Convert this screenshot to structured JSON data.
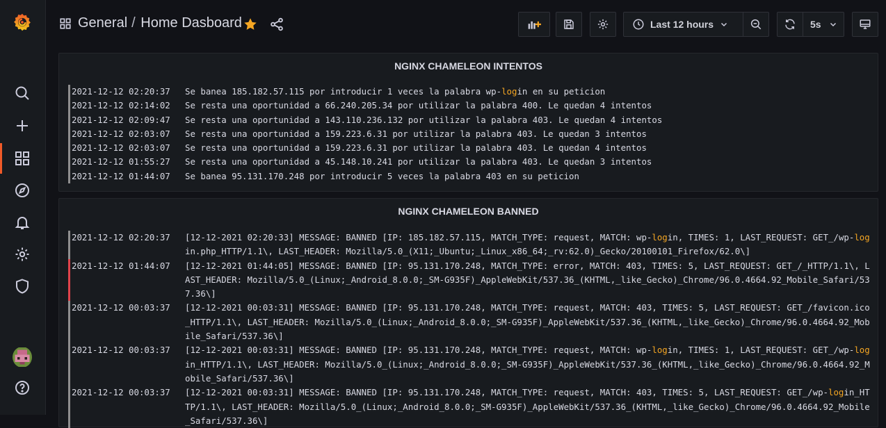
{
  "breadcrumb": {
    "folder": "General",
    "separator": "/",
    "dashboard": "Home Dasboard"
  },
  "toolbar": {
    "time_range": "Last 12 hours",
    "refresh_interval": "5s"
  },
  "colors": {
    "accent": "#f05a28",
    "highlight": "#f5a623",
    "error": "#e0434b"
  },
  "sidebar": {
    "icons": [
      "grafana-logo-icon",
      "search-icon",
      "plus-icon",
      "dashboards-icon",
      "explore-icon",
      "alert-bell-icon",
      "settings-gear-icon",
      "shield-icon",
      "user-avatar",
      "help-icon"
    ]
  },
  "panels": [
    {
      "title": "NGINX CHAMELEON INTENTOS",
      "rows": [
        {
          "ts": "2021-12-12 02:20:37",
          "parts": [
            "Se banea 185.182.57.115 por introducir 1 veces la palabra wp-",
            {
              "hl": "log"
            },
            "in en su peticion"
          ]
        },
        {
          "ts": "2021-12-12 02:14:02",
          "parts": [
            "Se resta una oportunidad a 66.240.205.34 por utilizar la palabra 400. Le quedan 4 intentos"
          ]
        },
        {
          "ts": "2021-12-12 02:09:47",
          "parts": [
            "Se resta una oportunidad a 143.110.236.132 por utilizar la palabra 403. Le quedan 4 intentos"
          ]
        },
        {
          "ts": "2021-12-12 02:03:07",
          "parts": [
            "Se resta una oportunidad a 159.223.6.31 por utilizar la palabra 403. Le quedan 3 intentos"
          ]
        },
        {
          "ts": "2021-12-12 02:03:07",
          "parts": [
            "Se resta una oportunidad a 159.223.6.31 por utilizar la palabra 403. Le quedan 4 intentos"
          ]
        },
        {
          "ts": "2021-12-12 01:55:27",
          "parts": [
            "Se resta una oportunidad a 45.148.10.241 por utilizar la palabra 403. Le quedan 3 intentos"
          ]
        },
        {
          "ts": "2021-12-12 01:44:07",
          "parts": [
            "Se banea 95.131.170.248 por introducir 5 veces la palabra 403 en su peticion"
          ]
        }
      ]
    },
    {
      "title": "NGINX CHAMELEON BANNED",
      "rows": [
        {
          "ts": "2021-12-12 02:20:37",
          "level": "info",
          "parts": [
            "[12-12-2021 02:20:33] MESSAGE: BANNED [IP: 185.182.57.115, MATCH_TYPE: request, MATCH: wp-",
            {
              "hl": "log"
            },
            "in, TIMES: 1, LAST_REQUEST: GET_/wp-",
            {
              "hl": "log"
            },
            "in.php_HTTP/1.1\\, LAST_HEADER: Mozilla/5.0_(X11;_Ubuntu;_Linux_x86_64;_rv:62.0)_Gecko/20100101_Firefox/62.0\\]"
          ]
        },
        {
          "ts": "2021-12-12 01:44:07",
          "level": "error",
          "parts": [
            "[12-12-2021 01:44:05] MESSAGE: BANNED [IP: 95.131.170.248, MATCH_TYPE: error, MATCH: 403, TIMES: 5, LAST_REQUEST: GET_/_HTTP/1.1\\, LAST_HEADER: Mozilla/5.0_(Linux;_Android_8.0.0;_SM-G935F)_AppleWebKit/537.36_(KHTML,_like_Gecko)_Chrome/96.0.4664.92_Mobile_Safari/537.36\\]"
          ]
        },
        {
          "ts": "2021-12-12 00:03:37",
          "level": "info",
          "parts": [
            "[12-12-2021 00:03:31] MESSAGE: BANNED [IP: 95.131.170.248, MATCH_TYPE: request, MATCH: 403, TIMES: 5, LAST_REQUEST: GET_/favicon.ico_HTTP/1.1\\, LAST_HEADER: Mozilla/5.0_(Linux;_Android_8.0.0;_SM-G935F)_AppleWebKit/537.36_(KHTML,_like_Gecko)_Chrome/96.0.4664.92_Mobile_Safari/537.36\\]"
          ]
        },
        {
          "ts": "2021-12-12 00:03:37",
          "level": "info",
          "parts": [
            "[12-12-2021 00:03:31] MESSAGE: BANNED [IP: 95.131.170.248, MATCH_TYPE: request, MATCH: wp-",
            {
              "hl": "log"
            },
            "in, TIMES: 1, LAST_REQUEST: GET_/wp-",
            {
              "hl": "log"
            },
            "in_HTTP/1.1\\, LAST_HEADER: Mozilla/5.0_(Linux;_Android_8.0.0;_SM-G935F)_AppleWebKit/537.36_(KHTML,_like_Gecko)_Chrome/96.0.4664.92_Mobile_Safari/537.36\\]"
          ]
        },
        {
          "ts": "2021-12-12 00:03:37",
          "level": "info",
          "parts": [
            "[12-12-2021 00:03:31] MESSAGE: BANNED [IP: 95.131.170.248, MATCH_TYPE: request, MATCH: 403, TIMES: 5, LAST_REQUEST: GET_/wp-",
            {
              "hl": "log"
            },
            "in_HTTP/1.1\\, LAST_HEADER: Mozilla/5.0_(Linux;_Android_8.0.0;_SM-G935F)_AppleWebKit/537.36_(KHTML,_like_Gecko)_Chrome/96.0.4664.92_Mobile_Safari/537.36\\]"
          ]
        }
      ]
    }
  ]
}
